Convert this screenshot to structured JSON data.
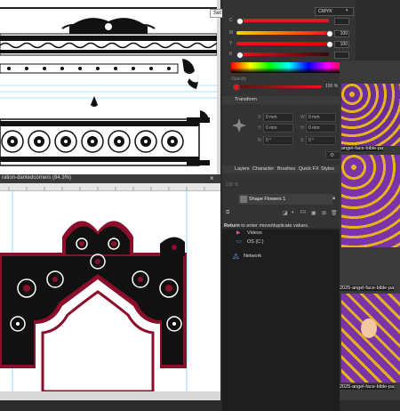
{
  "tooltip": {
    "set_stroke": "Set Stroke"
  },
  "color_panel": {
    "mode": "CMYK",
    "channels": [
      {
        "label": "C",
        "value": "",
        "color": "#e8171f"
      },
      {
        "label": "M",
        "value": "100",
        "color": "#e8171f"
      },
      {
        "label": "Y",
        "value": "100",
        "color": "#c9c900"
      },
      {
        "label": "K",
        "value": "",
        "color": "#555555"
      }
    ],
    "opacity_label": "Opacity",
    "opacity_value": "100 %"
  },
  "transform_panel": {
    "title": "Transform",
    "fields": {
      "x": "0 mm",
      "y": "0 mm",
      "w": "0 mm",
      "h": "0 mm",
      "r": "0 °",
      "s": "0 °"
    },
    "labels": {
      "x": "X:",
      "y": "Y:",
      "w": "W:",
      "h": "H:",
      "r": "R:",
      "s": "S:"
    }
  },
  "layers_panel": {
    "tabs": [
      "Layers",
      "Character",
      "Brushes",
      "Quick FX",
      "Styles"
    ],
    "opacity": "100 %",
    "layer_name": "Shape Flowers 1"
  },
  "status": {
    "hint_bold": "Return",
    "hint_rest": " to enter move/duplicate values."
  },
  "explorer": {
    "items": [
      {
        "label": "Videos",
        "icon": "videos-icon"
      },
      {
        "label": "OS (C:)",
        "icon": "drive-icon"
      },
      {
        "label": "Network",
        "icon": "network-icon"
      }
    ]
  },
  "document2": {
    "title": "ration-dantedcorners (84.3%)",
    "close": "×"
  },
  "thumbnails": [
    {
      "caption": "",
      "colors": [
        "#6b2f9a",
        "#e6b21d"
      ]
    },
    {
      "caption": "angel-face-bible-pa",
      "colors": [
        "#6b2f9a",
        "#e6b21d"
      ]
    },
    {
      "caption": "2025-angel-face-bible-pa",
      "colors": [
        "#6b2f9a",
        "#e6b21d"
      ]
    },
    {
      "caption": "2025-angel-face-bible-pa",
      "colors": [
        "#6b2f9a",
        "#e6b21d"
      ]
    }
  ],
  "colors": {
    "accent_red": "#8b0f2b",
    "panel_bg": "#333333"
  }
}
